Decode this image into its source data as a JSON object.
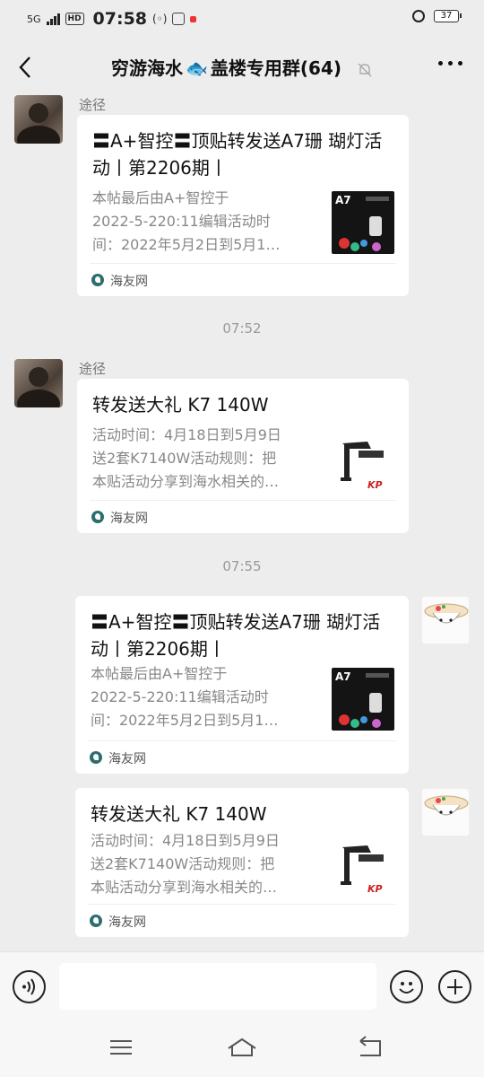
{
  "status": {
    "network": "5G",
    "hd": "HD",
    "time": "07:58",
    "battery": "37"
  },
  "header": {
    "title_before": "穷游海水",
    "title_emoji": "🐟",
    "title_after": "盖楼专用群(64)"
  },
  "messages": [
    {
      "sender": "途径",
      "title": "〓A+智控〓顶贴转发送A7珊 瑚灯活动丨第2206期丨",
      "desc": [
        "本帖最后由A+智控于",
        "2022-5-220:11编辑活动时",
        "间：2022年5月2日到5月1…"
      ],
      "source": "海友网",
      "thumb_label": "A7"
    },
    {
      "sender": "途径",
      "title": "转发送大礼 K7 140W",
      "desc": [
        "活动时间：4月18日到5月9日",
        "送2套K7140W活动规则：把",
        "本贴活动分享到海水相关的…"
      ],
      "source": "海友网",
      "thumb_label": "KP"
    },
    {
      "title": "〓A+智控〓顶贴转发送A7珊 瑚灯活动丨第2206期丨",
      "desc": [
        "本帖最后由A+智控于",
        "2022-5-220:11编辑活动时",
        "间：2022年5月2日到5月1…"
      ],
      "source": "海友网",
      "thumb_label": "A7"
    },
    {
      "title": "转发送大礼 K7 140W",
      "desc": [
        "活动时间：4月18日到5月9日",
        "送2套K7140W活动规则：把",
        "本贴活动分享到海水相关的…"
      ],
      "source": "海友网",
      "thumb_label": "KP"
    }
  ],
  "timestamps": [
    "07:52",
    "07:55"
  ],
  "colors": {
    "chat_background": "#ededed",
    "card_background": "#ffffff",
    "secondary_text": "#888888",
    "source_icon": "#2d6d6d"
  },
  "icons": {
    "back": "chevron-left-icon",
    "mute": "bell-off-icon",
    "more": "more-dots-icon",
    "voice": "voice-icon",
    "emoji": "emoji-icon",
    "plus": "plus-icon",
    "menu": "menu-icon",
    "home": "home-icon",
    "return": "return-icon"
  }
}
